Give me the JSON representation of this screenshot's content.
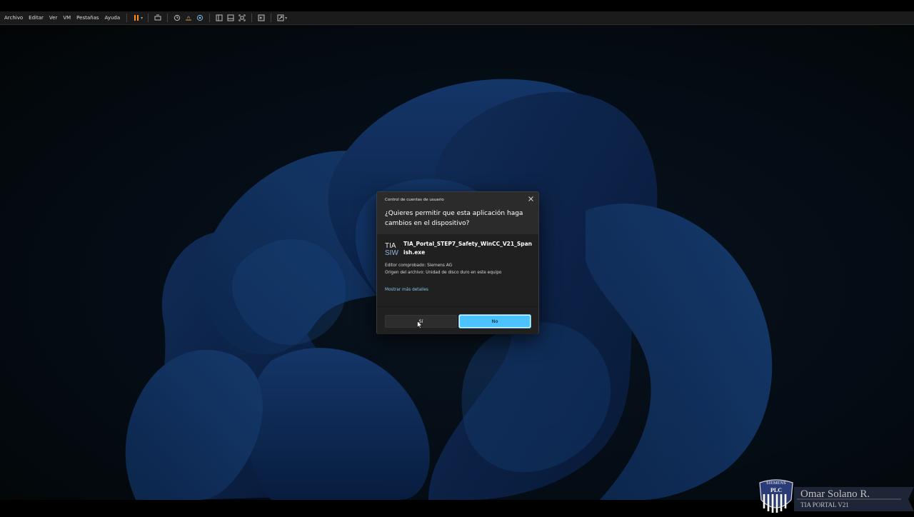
{
  "menu": {
    "items": [
      "Archivo",
      "Editar",
      "Ver",
      "VM",
      "Pestañas",
      "Ayuda"
    ]
  },
  "toolbar": {
    "icons": [
      "pause-icon",
      "send-keys-icon",
      "snapshot-icon",
      "revert-snapshot-icon",
      "manage-snapshots-icon",
      "sidebar-icon",
      "thumbnail-icon",
      "fullscreen-icon",
      "console-icon",
      "unity-icon"
    ],
    "pause_color": "#ff8c1a"
  },
  "uac": {
    "caption": "Control de cuentas de usuario",
    "question": "¿Quieres permitir que esta aplicación haga cambios en el dispositivo?",
    "app_logo_top": "TIA",
    "app_logo_bottom": "SIW",
    "app_name": "TIA_Portal_STEP7_Safety_WinCC_V21_Spanish.exe",
    "publisher": "Editor comprobado: Siemens AG",
    "origin": "Origen del archivo: Unidad de disco duro en este equipo",
    "details_link": "Mostrar más detalles",
    "yes_label": "Sí",
    "no_label": "No",
    "accent_color": "#4cc2ff"
  },
  "watermark": {
    "badge_top": "SIEMENS",
    "badge_middle": "PLC",
    "name": "Omar Solano R.",
    "subtitle": "TIA PORTAL V21"
  }
}
